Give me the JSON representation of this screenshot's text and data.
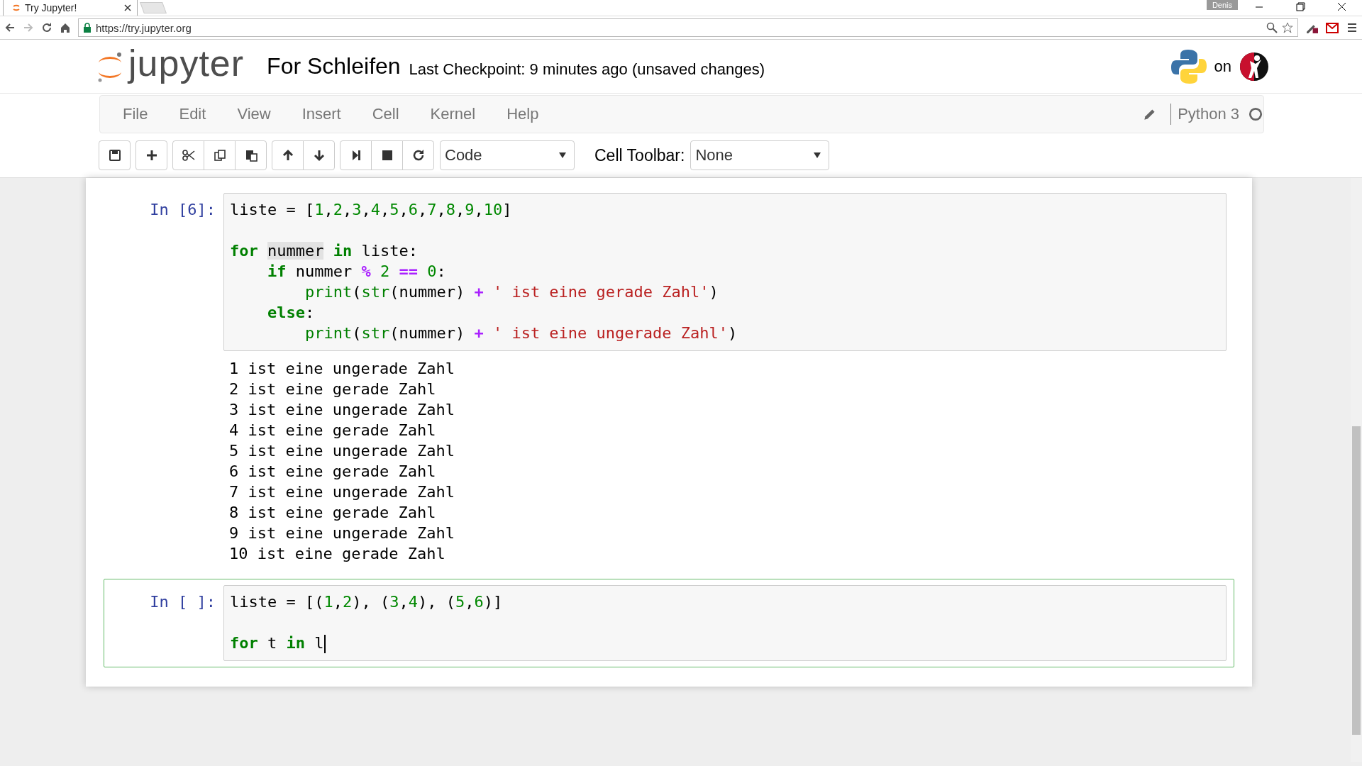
{
  "browser": {
    "tab": {
      "title": "Try Jupyter!"
    },
    "url": "https://try.jupyter.org",
    "user": "Denis"
  },
  "header": {
    "logo_text": "jupyter",
    "notebook_name": "For Schleifen",
    "checkpoint": "Last Checkpoint: 9 minutes ago (unsaved changes)",
    "on_label": "on"
  },
  "menu": {
    "items": [
      "File",
      "Edit",
      "View",
      "Insert",
      "Cell",
      "Kernel",
      "Help"
    ],
    "kernel": "Python 3"
  },
  "toolbar": {
    "cell_type": "Code",
    "cell_toolbar_label": "Cell Toolbar:",
    "cell_toolbar_value": "None"
  },
  "cells": [
    {
      "prompt": "In [6]:",
      "selected": false,
      "blocks": [
        {
          "lines": [
            {
              "tokens": [
                {
                  "kind": "plain",
                  "text": "liste = ["
                },
                {
                  "kind": "num",
                  "text": "1"
                },
                {
                  "kind": "plain",
                  "text": ","
                },
                {
                  "kind": "num",
                  "text": "2"
                },
                {
                  "kind": "plain",
                  "text": ","
                },
                {
                  "kind": "num",
                  "text": "3"
                },
                {
                  "kind": "plain",
                  "text": ","
                },
                {
                  "kind": "num",
                  "text": "4"
                },
                {
                  "kind": "plain",
                  "text": ","
                },
                {
                  "kind": "num",
                  "text": "5"
                },
                {
                  "kind": "plain",
                  "text": ","
                },
                {
                  "kind": "num",
                  "text": "6"
                },
                {
                  "kind": "plain",
                  "text": ","
                },
                {
                  "kind": "num",
                  "text": "7"
                },
                {
                  "kind": "plain",
                  "text": ","
                },
                {
                  "kind": "num",
                  "text": "8"
                },
                {
                  "kind": "plain",
                  "text": ","
                },
                {
                  "kind": "num",
                  "text": "9"
                },
                {
                  "kind": "plain",
                  "text": ","
                },
                {
                  "kind": "num",
                  "text": "10"
                },
                {
                  "kind": "plain",
                  "text": "]"
                }
              ]
            }
          ]
        },
        {
          "lines": [
            {
              "tokens": [
                {
                  "kind": "kw",
                  "text": "for "
                },
                {
                  "kind": "match",
                  "text": "nummer"
                },
                {
                  "kind": "kw",
                  "text": " in"
                },
                {
                  "kind": "plain",
                  "text": " liste:"
                }
              ]
            },
            {
              "tokens": [
                {
                  "kind": "kw",
                  "text": "    if"
                },
                {
                  "kind": "plain",
                  "text": " nummer "
                },
                {
                  "kind": "op",
                  "text": "%"
                },
                {
                  "kind": "num",
                  "text": " 2 "
                },
                {
                  "kind": "op",
                  "text": "=="
                },
                {
                  "kind": "num",
                  "text": " 0"
                },
                {
                  "kind": "plain",
                  "text": ":"
                }
              ]
            },
            {
              "tokens": [
                {
                  "kind": "builtin",
                  "text": "        print"
                },
                {
                  "kind": "plain",
                  "text": "("
                },
                {
                  "kind": "builtin",
                  "text": "str"
                },
                {
                  "kind": "plain",
                  "text": "(nummer) "
                },
                {
                  "kind": "op",
                  "text": "+"
                },
                {
                  "kind": "str",
                  "text": " ' ist eine gerade Zahl'"
                },
                {
                  "kind": "plain",
                  "text": ")"
                }
              ]
            },
            {
              "tokens": [
                {
                  "kind": "kw",
                  "text": "    else"
                },
                {
                  "kind": "plain",
                  "text": ":"
                }
              ]
            },
            {
              "tokens": [
                {
                  "kind": "builtin",
                  "text": "        print"
                },
                {
                  "kind": "plain",
                  "text": "("
                },
                {
                  "kind": "builtin",
                  "text": "str"
                },
                {
                  "kind": "plain",
                  "text": "(nummer) "
                },
                {
                  "kind": "op",
                  "text": "+"
                },
                {
                  "kind": "str",
                  "text": " ' ist eine ungerade Zahl'"
                },
                {
                  "kind": "plain",
                  "text": ")"
                }
              ]
            }
          ]
        }
      ],
      "output": [
        "1 ist eine ungerade Zahl",
        "2 ist eine gerade Zahl",
        "3 ist eine ungerade Zahl",
        "4 ist eine gerade Zahl",
        "5 ist eine ungerade Zahl",
        "6 ist eine gerade Zahl",
        "7 ist eine ungerade Zahl",
        "8 ist eine gerade Zahl",
        "9 ist eine ungerade Zahl",
        "10 ist eine gerade Zahl"
      ]
    },
    {
      "prompt": "In [ ]:",
      "selected": true,
      "blocks": [
        {
          "lines": [
            {
              "tokens": [
                {
                  "kind": "plain",
                  "text": "liste = [("
                },
                {
                  "kind": "num",
                  "text": "1"
                },
                {
                  "kind": "plain",
                  "text": ","
                },
                {
                  "kind": "num",
                  "text": "2"
                },
                {
                  "kind": "plain",
                  "text": "), ("
                },
                {
                  "kind": "num",
                  "text": "3"
                },
                {
                  "kind": "plain",
                  "text": ","
                },
                {
                  "kind": "num",
                  "text": "4"
                },
                {
                  "kind": "plain",
                  "text": "), ("
                },
                {
                  "kind": "num",
                  "text": "5"
                },
                {
                  "kind": "plain",
                  "text": ","
                },
                {
                  "kind": "num",
                  "text": "6"
                },
                {
                  "kind": "plain",
                  "text": ")]"
                }
              ]
            }
          ]
        },
        {
          "lines": [
            {
              "cursor": true,
              "tokens": [
                {
                  "kind": "kw",
                  "text": "for"
                },
                {
                  "kind": "plain",
                  "text": " t "
                },
                {
                  "kind": "kw",
                  "text": "in"
                },
                {
                  "kind": "plain",
                  "text": " l"
                }
              ]
            }
          ]
        }
      ]
    }
  ]
}
